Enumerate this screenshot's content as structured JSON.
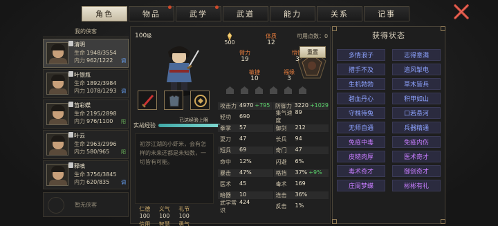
{
  "tabs": [
    {
      "label": "角色",
      "active": true,
      "dot": false
    },
    {
      "label": "物品",
      "active": false,
      "dot": true
    },
    {
      "label": "武学",
      "active": false,
      "dot": true
    },
    {
      "label": "武道",
      "active": false,
      "dot": false
    },
    {
      "label": "能力",
      "active": false,
      "dot": false
    },
    {
      "label": "关系",
      "active": false,
      "dot": false
    },
    {
      "label": "记事",
      "active": false,
      "dot": false
    }
  ],
  "roster": {
    "header": "我的侠客",
    "members": [
      {
        "name": "清明",
        "hp_label": "生命",
        "hp": "1948/3554",
        "mp_label": "内力",
        "mp": "962/1222",
        "tag": "调",
        "active": true
      },
      {
        "name": "叶银瓶",
        "hp_label": "生命",
        "hp": "1892/3984",
        "mp_label": "内力",
        "mp": "1078/1293",
        "tag": "调",
        "active": false
      },
      {
        "name": "苗彩蝶",
        "hp_label": "生命",
        "hp": "2195/2898",
        "mp_label": "内力",
        "mp": "976/1100",
        "tag": "阳",
        "active": false
      },
      {
        "name": "叶云",
        "hp_label": "生命",
        "hp": "2963/2996",
        "mp_label": "内力",
        "mp": "580/965",
        "tag": "阳",
        "active": false
      },
      {
        "name": "释嗔",
        "hp_label": "生命",
        "hp": "3756/3845",
        "mp_label": "内力",
        "mp": "620/835",
        "tag": "调",
        "active": false
      }
    ],
    "empty_label": "暂无侠客"
  },
  "character": {
    "level": "100",
    "level_unit": "级",
    "potential": "500",
    "points_label": "可用点数：",
    "points": "0",
    "reset_label": "重置",
    "xp_label": "实战经验",
    "xp_status": "已达经验上限",
    "xp_fill": 1.0,
    "bio": "初涉江湖的小虾米，会有怎样的未来还都是未知数，一切皆有可能。"
  },
  "attributes": {
    "tizhi": {
      "label": "体质",
      "value": "12"
    },
    "biili": {
      "label": "臂力",
      "value": "19"
    },
    "wuxing": {
      "label": "悟性",
      "value": "3"
    },
    "minjie": {
      "label": "敏捷",
      "value": "10"
    },
    "fuyuan": {
      "label": "福缘",
      "value": "3"
    }
  },
  "stats": [
    [
      {
        "k": "攻击力",
        "v": "4970",
        "plus": "+795"
      },
      {
        "k": "防御力",
        "v": "3220",
        "plus": "+1029"
      }
    ],
    [
      {
        "k": "轻功",
        "v": "690",
        "plus": ""
      },
      {
        "k": "集气速度",
        "v": "89",
        "plus": ""
      }
    ],
    [
      {
        "k": "拳掌",
        "v": "57",
        "plus": ""
      },
      {
        "k": "御剑",
        "v": "212",
        "plus": ""
      }
    ],
    [
      {
        "k": "耍刀",
        "v": "47",
        "plus": ""
      },
      {
        "k": "长兵",
        "v": "94",
        "plus": ""
      }
    ],
    [
      {
        "k": "短兵",
        "v": "69",
        "plus": ""
      },
      {
        "k": "奇门",
        "v": "47",
        "plus": ""
      }
    ],
    [
      {
        "k": "命中",
        "v": "12%",
        "plus": ""
      },
      {
        "k": "闪避",
        "v": "6%",
        "plus": ""
      }
    ],
    [
      {
        "k": "暴击",
        "v": "47%",
        "plus": ""
      },
      {
        "k": "格挡",
        "v": "37%",
        "plus": "+9%"
      }
    ],
    [
      {
        "k": "医术",
        "v": "45",
        "plus": ""
      },
      {
        "k": "毒术",
        "v": "169",
        "plus": ""
      }
    ],
    [
      {
        "k": "暗器",
        "v": "10",
        "plus": ""
      },
      {
        "k": "连击",
        "v": "36%",
        "plus": ""
      }
    ],
    [
      {
        "k": "武学常识",
        "v": "424",
        "plus": ""
      },
      {
        "k": "反击",
        "v": "1%",
        "plus": ""
      }
    ]
  ],
  "virtues": [
    {
      "k": "仁德",
      "v": "100"
    },
    {
      "k": "义气",
      "v": "100"
    },
    {
      "k": "礼节",
      "v": "100"
    },
    {
      "k": "",
      "v": ""
    },
    {
      "k": "信用",
      "v": "100"
    },
    {
      "k": "智慧",
      "v": "100"
    },
    {
      "k": "勇气",
      "v": "100"
    },
    {
      "k": "",
      "v": ""
    }
  ],
  "status_panel": {
    "title": "获得状态",
    "items": [
      {
        "label": "多情浪子",
        "color": "blue"
      },
      {
        "label": "志得意满",
        "color": "blue"
      },
      {
        "label": "措手不及",
        "color": "blue"
      },
      {
        "label": "追风掣电",
        "color": "blue"
      },
      {
        "label": "生机勃勃",
        "color": "blue"
      },
      {
        "label": "草木皆兵",
        "color": "blue"
      },
      {
        "label": "碧血丹心",
        "color": "blue"
      },
      {
        "label": "积甲如山",
        "color": "blue"
      },
      {
        "label": "守株待兔",
        "color": "blue"
      },
      {
        "label": "口若悬河",
        "color": "blue"
      },
      {
        "label": "无师自通",
        "color": "blue"
      },
      {
        "label": "兵器精通",
        "color": "blue"
      },
      {
        "label": "免疫中毒",
        "color": "purple"
      },
      {
        "label": "免疫内伤",
        "color": "purple"
      },
      {
        "label": "皮糙肉厚",
        "color": "purple"
      },
      {
        "label": "医术奇才",
        "color": "purple"
      },
      {
        "label": "毒术奇才",
        "color": "purple"
      },
      {
        "label": "御剑奇才",
        "color": "purple"
      },
      {
        "label": "庄周梦蝶",
        "color": "purple"
      },
      {
        "label": "彬彬有礼",
        "color": "purple"
      }
    ]
  }
}
